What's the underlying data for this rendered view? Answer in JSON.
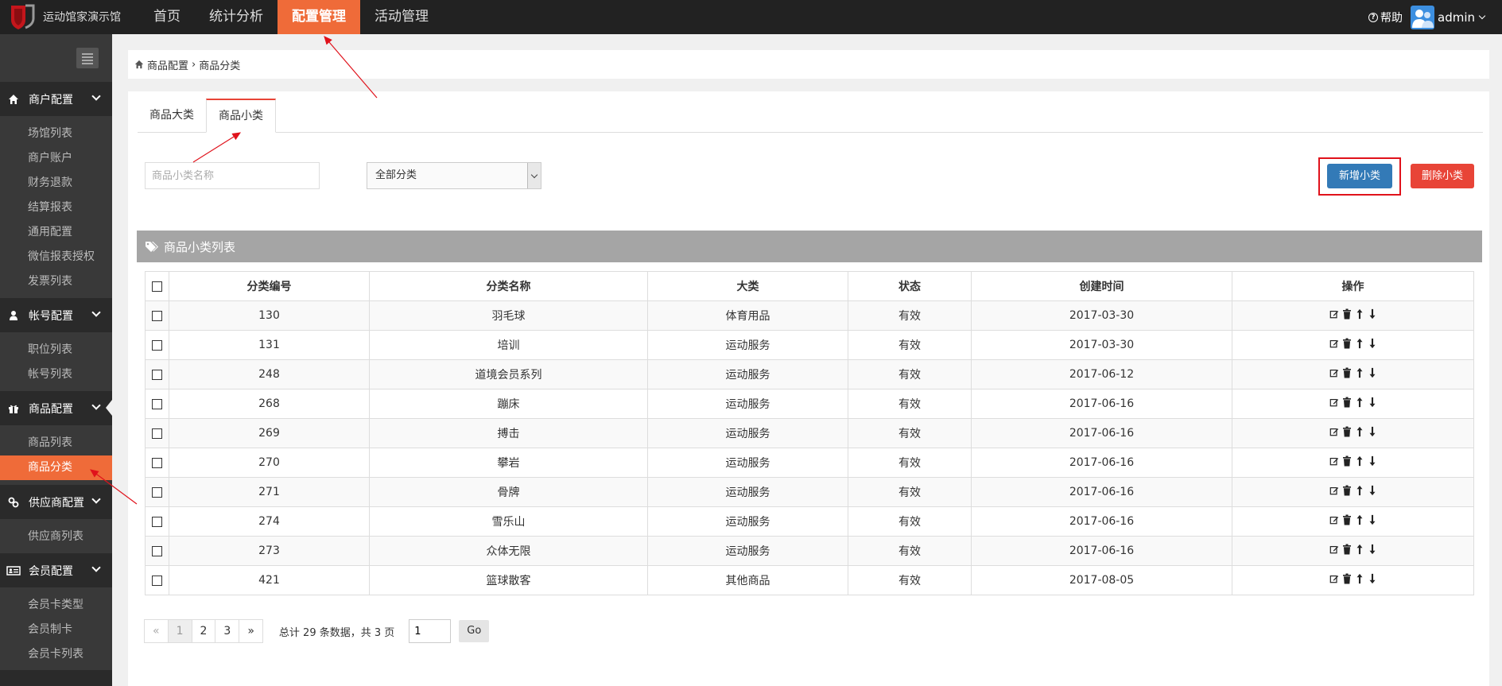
{
  "app": {
    "logo_text": "运动馆家演示馆"
  },
  "topnav": [
    {
      "label": "首页"
    },
    {
      "label": "统计分析"
    },
    {
      "label": "配置管理",
      "active": true
    },
    {
      "label": "活动管理"
    }
  ],
  "header": {
    "help_label": "帮助",
    "user_name": "admin"
  },
  "sidebar": {
    "groups": [
      {
        "label": "商户配置",
        "icon": "home-icon",
        "items": [
          "场馆列表",
          "商户账户",
          "财务退款",
          "结算报表",
          "通用配置",
          "微信报表授权",
          "发票列表"
        ]
      },
      {
        "label": "帐号配置",
        "icon": "user-icon",
        "items": [
          "职位列表",
          "帐号列表"
        ]
      },
      {
        "label": "商品配置",
        "icon": "gift-icon",
        "items": [
          "商品列表",
          "商品分类"
        ]
      },
      {
        "label": "供应商配置",
        "icon": "link-icon",
        "items": [
          "供应商列表"
        ]
      },
      {
        "label": "会员配置",
        "icon": "id-card-icon",
        "items": [
          "会员卡类型",
          "会员制卡",
          "会员卡列表"
        ]
      }
    ],
    "active_item": "商品分类"
  },
  "breadcrumb": {
    "parent": "商品配置",
    "separator": "›",
    "current": "商品分类"
  },
  "tabs": [
    {
      "label": "商品大类"
    },
    {
      "label": "商品小类",
      "active": true
    }
  ],
  "filters": {
    "name_placeholder": "商品小类名称",
    "category_selected": "全部分类"
  },
  "actions": {
    "add_label": "新增小类",
    "delete_label": "删除小类"
  },
  "list": {
    "title": "商品小类列表",
    "columns": [
      "分类编号",
      "分类名称",
      "大类",
      "状态",
      "创建时间",
      "操作"
    ],
    "rows": [
      {
        "id": "130",
        "name": "羽毛球",
        "category": "体育用品",
        "status": "有效",
        "created": "2017-03-30"
      },
      {
        "id": "131",
        "name": "培训",
        "category": "运动服务",
        "status": "有效",
        "created": "2017-03-30"
      },
      {
        "id": "248",
        "name": "道境会员系列",
        "category": "运动服务",
        "status": "有效",
        "created": "2017-06-12"
      },
      {
        "id": "268",
        "name": "蹦床",
        "category": "运动服务",
        "status": "有效",
        "created": "2017-06-16"
      },
      {
        "id": "269",
        "name": "搏击",
        "category": "运动服务",
        "status": "有效",
        "created": "2017-06-16"
      },
      {
        "id": "270",
        "name": "攀岩",
        "category": "运动服务",
        "status": "有效",
        "created": "2017-06-16"
      },
      {
        "id": "271",
        "name": "骨牌",
        "category": "运动服务",
        "status": "有效",
        "created": "2017-06-16"
      },
      {
        "id": "274",
        "name": "雪乐山",
        "category": "运动服务",
        "status": "有效",
        "created": "2017-06-16"
      },
      {
        "id": "273",
        "name": "众体无限",
        "category": "运动服务",
        "status": "有效",
        "created": "2017-06-16"
      },
      {
        "id": "421",
        "name": "篮球散客",
        "category": "其他商品",
        "status": "有效",
        "created": "2017-08-05"
      }
    ]
  },
  "pagination": {
    "prev": "«",
    "pages": [
      "1",
      "2",
      "3"
    ],
    "current": "1",
    "next": "»",
    "summary": "总计 29 条数据，共 3 页",
    "jump_value": "1",
    "go_label": "Go"
  },
  "colors": {
    "accent": "#ef6b39",
    "primary": "#337ab7",
    "danger": "#e84437",
    "highlight_frame": "#e0121b"
  }
}
